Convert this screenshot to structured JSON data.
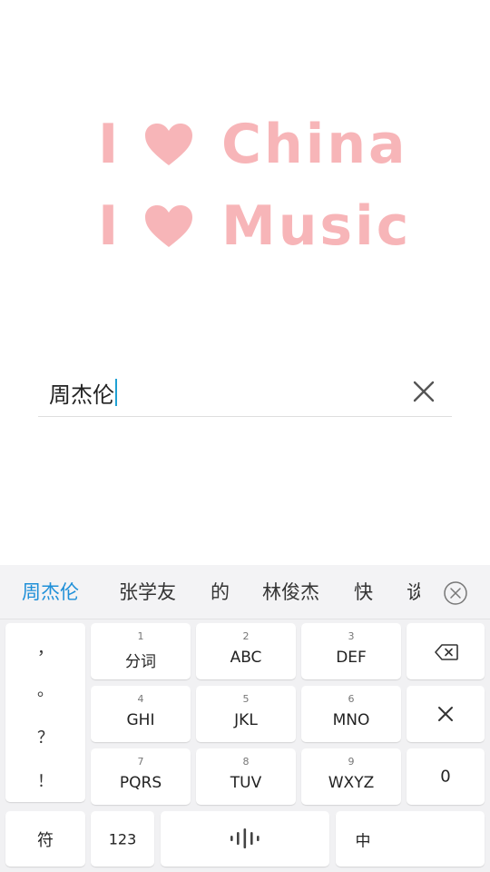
{
  "hero": {
    "line1_i": "I",
    "line1_word": "China",
    "line2_i": "I",
    "line2_word": "Music",
    "accent_color": "#f7b5b8"
  },
  "search": {
    "value": "周杰伦"
  },
  "keyboard": {
    "candidates": [
      "周杰伦",
      "张学友",
      "的",
      "林俊杰",
      "快",
      "谈"
    ],
    "punctuation": [
      "，",
      "。",
      "？",
      "！"
    ],
    "keys": [
      {
        "num": "1",
        "label": "分词"
      },
      {
        "num": "2",
        "label": "ABC"
      },
      {
        "num": "3",
        "label": "DEF"
      },
      {
        "num": "4",
        "label": "GHI"
      },
      {
        "num": "5",
        "label": "JKL"
      },
      {
        "num": "6",
        "label": "MNO"
      },
      {
        "num": "7",
        "label": "PQRS"
      },
      {
        "num": "8",
        "label": "TUV"
      },
      {
        "num": "9",
        "label": "WXYZ"
      }
    ],
    "zero": "0",
    "symbols": "符",
    "numbers": "123",
    "lang": "中",
    "accent_color": "#1e8fd8"
  }
}
